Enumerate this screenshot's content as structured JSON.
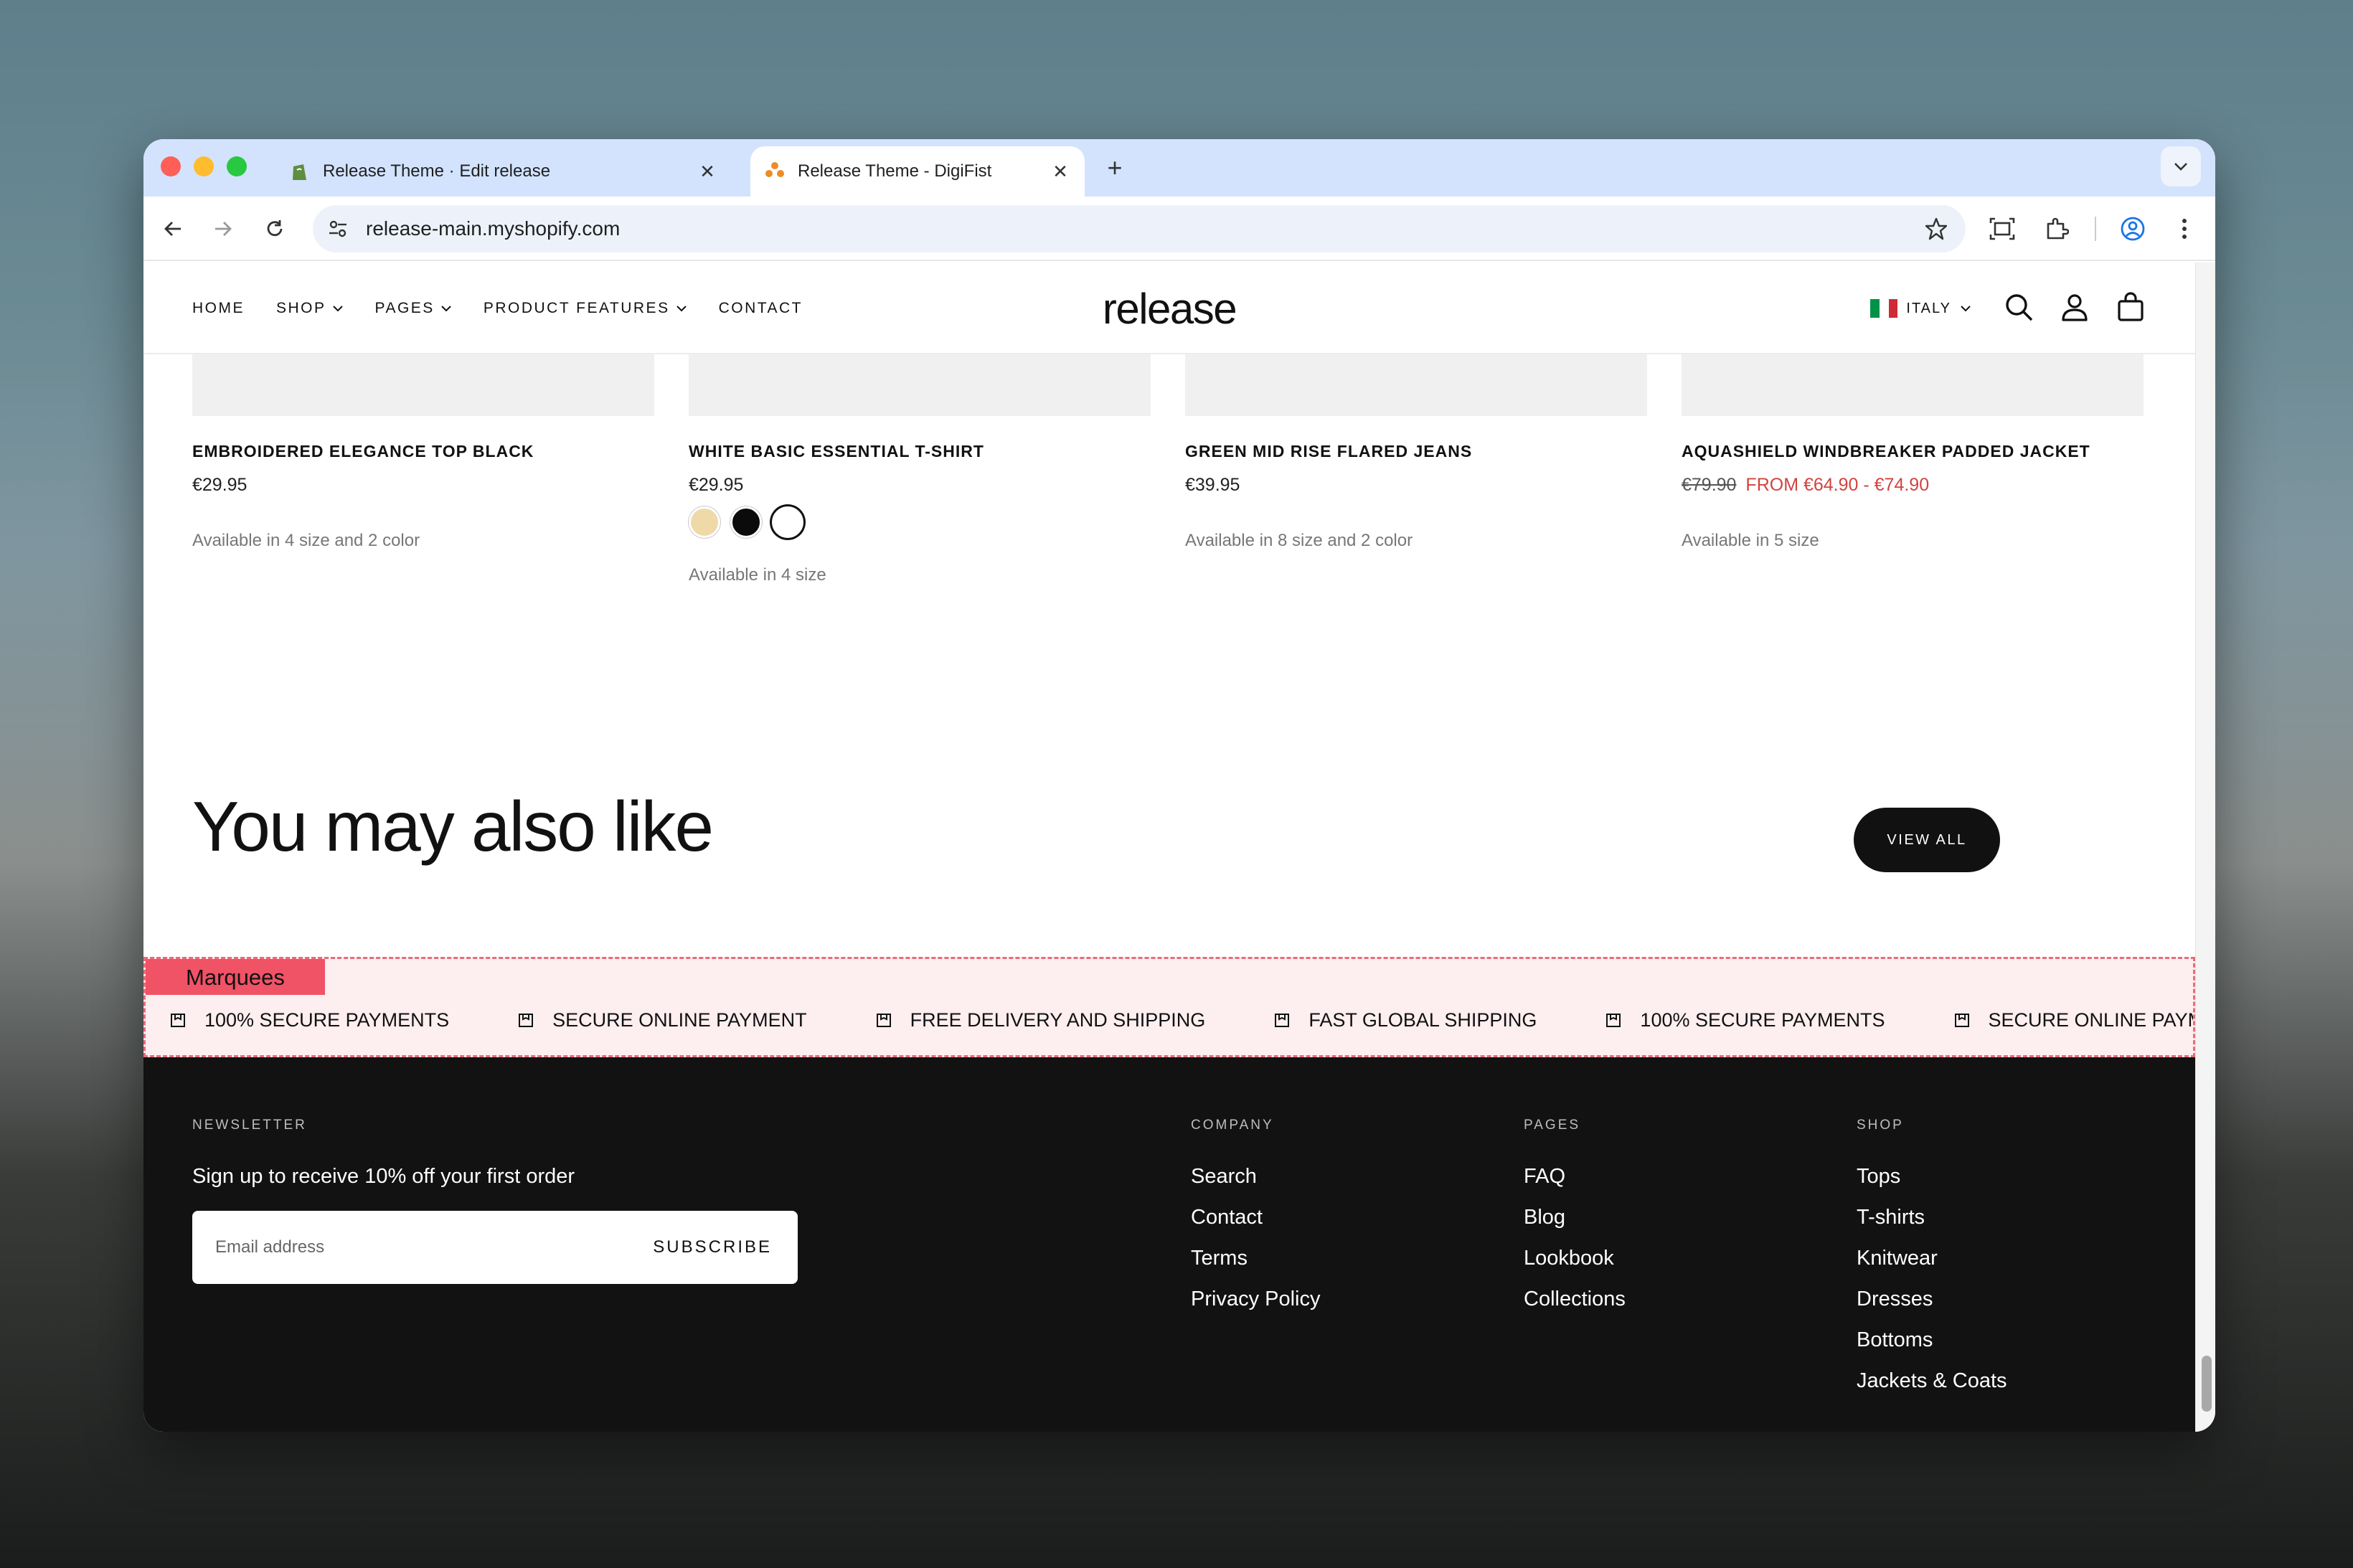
{
  "browser": {
    "tabs": [
      {
        "title": "Release Theme · Edit release",
        "active": false
      },
      {
        "title": "Release Theme - DigiFist",
        "active": true
      }
    ],
    "url": "release-main.myshopify.com"
  },
  "site": {
    "nav": [
      {
        "label": "HOME",
        "has_dropdown": false
      },
      {
        "label": "SHOP",
        "has_dropdown": true
      },
      {
        "label": "PAGES",
        "has_dropdown": true
      },
      {
        "label": "PRODUCT FEATURES",
        "has_dropdown": true
      },
      {
        "label": "CONTACT",
        "has_dropdown": false
      }
    ],
    "logo": "release",
    "country": "ITALY"
  },
  "products": [
    {
      "name": "EMBROIDERED ELEGANCE TOP BLACK",
      "price": "€29.95",
      "availability": "Available in 4 size and 2 color"
    },
    {
      "name": "WHITE BASIC ESSENTIAL T-SHIRT",
      "price": "€29.95",
      "availability": "Available in 4 size",
      "swatches": [
        "#efd9a8",
        "#0b0b0b",
        "#ffffff"
      ]
    },
    {
      "name": "GREEN MID RISE FLARED JEANS",
      "price": "€39.95",
      "availability": "Available in 8 size and 2 color"
    },
    {
      "name": "AQUASHIELD WINDBREAKER PADDED JACKET",
      "old_price": "€79.90",
      "sale_price": "FROM €64.90 - €74.90",
      "availability": "Available in 5 size"
    }
  ],
  "recommend": {
    "heading": "You may also like",
    "view_all": "VIEW ALL"
  },
  "marquee": {
    "tag": "Marquees",
    "items": [
      "100% SECURE PAYMENTS",
      "SECURE ONLINE PAYMENT",
      "FREE DELIVERY AND SHIPPING",
      "FAST GLOBAL SHIPPING",
      "100% SECURE PAYMENTS",
      "SECURE ONLINE PAYMENT"
    ]
  },
  "footer": {
    "newsletter": {
      "heading": "NEWSLETTER",
      "text": "Sign up to receive 10% off your first order",
      "placeholder": "Email address",
      "button": "SUBSCRIBE"
    },
    "company": {
      "heading": "COMPANY",
      "links": [
        "Search",
        "Contact",
        "Terms",
        "Privacy Policy"
      ]
    },
    "pages": {
      "heading": "PAGES",
      "links": [
        "FAQ",
        "Blog",
        "Lookbook",
        "Collections"
      ]
    },
    "shop": {
      "heading": "SHOP",
      "links": [
        "Tops",
        "T-shirts",
        "Knitwear",
        "Dresses",
        "Bottoms",
        "Jackets & Coats"
      ]
    }
  },
  "colors": {
    "sale": "#d2433f",
    "footer_bg": "#121212",
    "marquee_highlight": "#f05266"
  }
}
